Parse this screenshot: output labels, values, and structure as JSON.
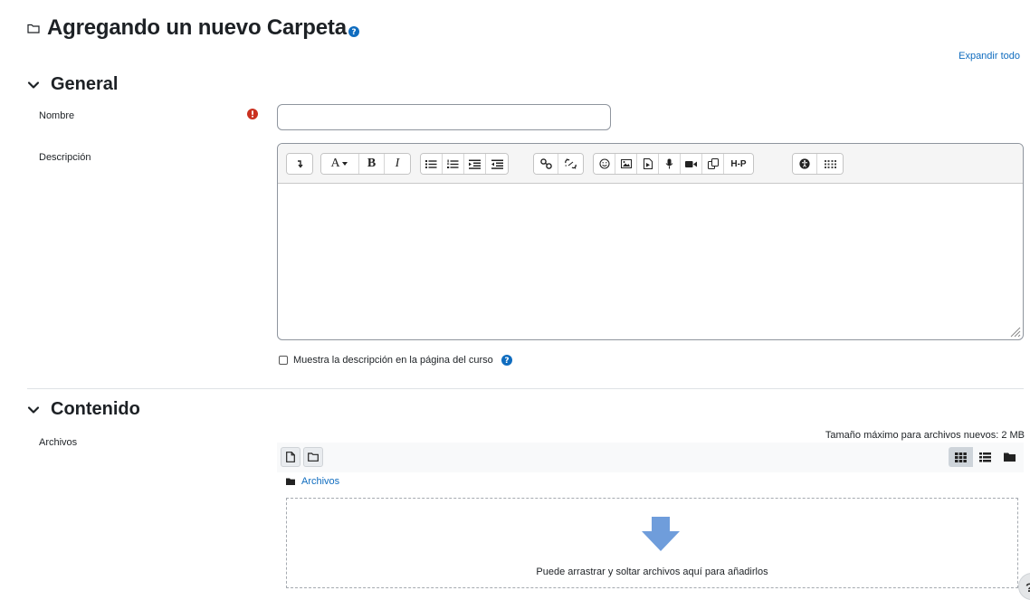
{
  "page": {
    "title": "Agregando un nuevo Carpeta",
    "expand_all": "Expandir todo"
  },
  "general": {
    "heading": "General",
    "name_label": "Nombre",
    "name_value": "",
    "description_label": "Descripción",
    "show_description": "Muestra la descripción en la página del curso",
    "show_description_checked": false
  },
  "toolbar": {
    "buttons": [
      "collapse",
      "font-style",
      "bold",
      "italic",
      "unordered-list",
      "ordered-list",
      "indent",
      "outdent",
      "link",
      "unlink",
      "emoji",
      "image",
      "media",
      "record-audio",
      "record-video",
      "manage-files",
      "h5p",
      "accessibility-checker",
      "screenreader-helper"
    ],
    "font_label": "A",
    "bold_label": "B",
    "italic_label": "I",
    "h5p_label": "H-P"
  },
  "content": {
    "heading": "Contenido",
    "files_label": "Archivos",
    "max_size": "Tamaño máximo para archivos nuevos: 2 MB",
    "path_folder": "Archivos",
    "drop_text": "Puede arrastrar y soltar archivos aquí para añadirlos",
    "view_modes": [
      "icons",
      "list",
      "tree"
    ],
    "active_view": "icons"
  },
  "colors": {
    "link": "#0f6cbf",
    "required": "#ca3120",
    "help": "#0f6cbf",
    "drop_arrow": "#6f9ddb"
  }
}
